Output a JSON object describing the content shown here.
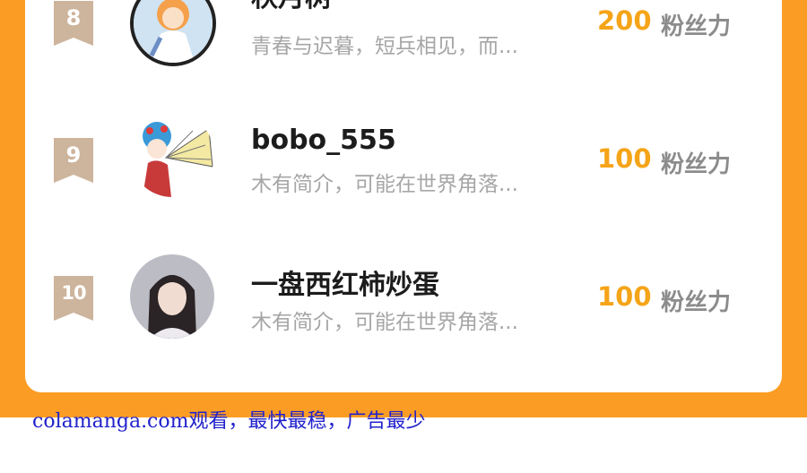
{
  "rows": [
    {
      "rank": "8",
      "name": "秋月树",
      "desc": "青春与迟暮，短兵相见，而...",
      "points": "200",
      "unit": "粉丝力"
    },
    {
      "rank": "9",
      "name": "bobo_555",
      "desc": "木有简介，可能在世界角落...",
      "points": "100",
      "unit": "粉丝力"
    },
    {
      "rank": "10",
      "name": "一盘西红柿炒蛋",
      "desc": "木有简介，可能在世界角落...",
      "points": "100",
      "unit": "粉丝力"
    }
  ],
  "watermark": "colamanga.com观看，最快最稳，广告最少",
  "colors": {
    "accent": "#fb9d24",
    "points": "#f5a418",
    "rank_badge": "#cdb49c"
  }
}
